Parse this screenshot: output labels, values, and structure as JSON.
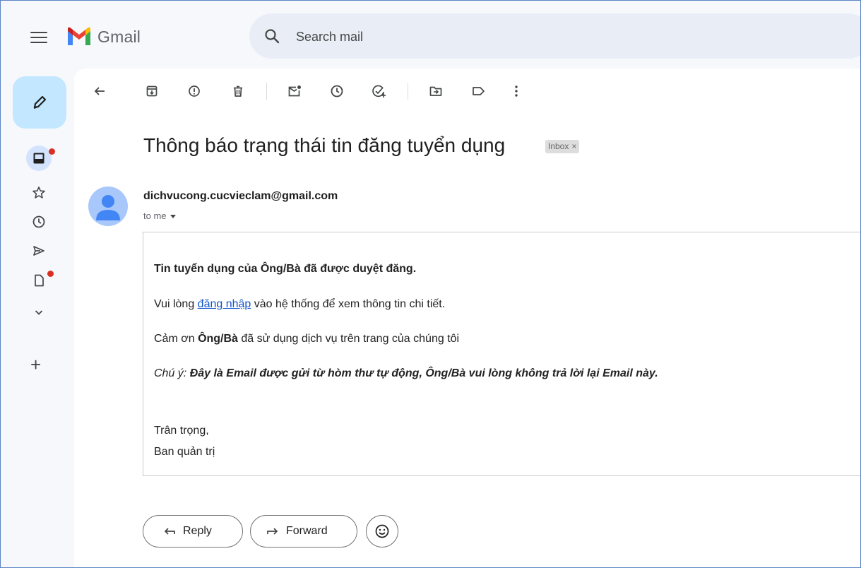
{
  "app": {
    "name": "Gmail"
  },
  "search": {
    "placeholder": "Search mail"
  },
  "nav": {
    "items": [
      "inbox-icon",
      "star-icon",
      "clock-icon",
      "send-icon",
      "draft-icon",
      "chevron-down-icon"
    ],
    "badges": {
      "inbox": true,
      "drafts": true
    }
  },
  "toolbar": {
    "icons": [
      "back-arrow-icon",
      "archive-icon",
      "report-spam-icon",
      "delete-icon",
      "mark-unread-icon",
      "snooze-icon",
      "add-task-icon",
      "move-to-icon",
      "label-icon",
      "more-icon"
    ]
  },
  "email": {
    "subject": "Thông báo trạng thái tin đăng tuyển dụng",
    "label": "Inbox",
    "label_close": "×",
    "sender": "dichvucong.cucvieclam@gmail.com",
    "recipient": "to me",
    "body": {
      "headline": "Tin tuyển dụng của Ông/Bà đã được duyệt đăng.",
      "line2_before": "Vui lòng ",
      "line2_link": "đăng nhập",
      "line2_after": " vào hệ thống để xem thông tin chi tiết.",
      "line3_before": "Cảm ơn ",
      "line3_bold": "Ông/Bà",
      "line3_after": " đã sử dụng dịch vụ trên trang của chúng tôi",
      "note_label": "Chú ý: ",
      "note_text": "Đây là Email được gửi từ hòm thư tự động, Ông/Bà vui lòng không trả lời lại Email này.",
      "closing": "Trân trọng,",
      "signature": "Ban quản trị"
    }
  },
  "actions": {
    "reply": "Reply",
    "forward": "Forward"
  },
  "colors": {
    "compose_bg": "#c2e7ff",
    "badge_red": "#d93025",
    "headline_red": "#e0170b",
    "link": "#1155cc"
  }
}
